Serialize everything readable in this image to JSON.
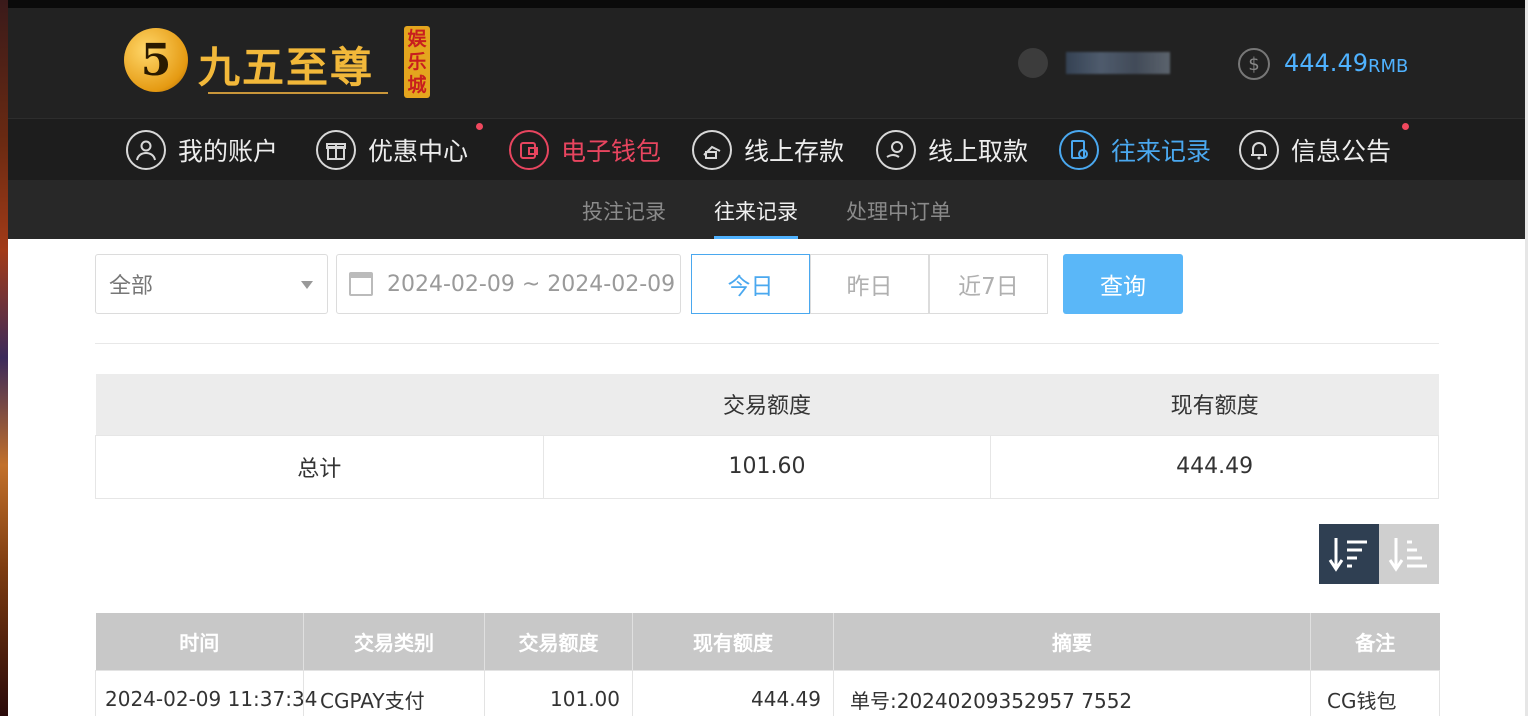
{
  "header": {
    "logo_badge": "5",
    "logo_text": "九五至尊",
    "logo_side": "娱乐城",
    "balance_amount": "444.49",
    "balance_unit": "RMB",
    "balance_icon": "dollar-icon"
  },
  "main_nav": [
    {
      "label": "我的账户",
      "icon": "user-icon",
      "state": "normal",
      "dot": false
    },
    {
      "label": "优惠中心",
      "icon": "gift-icon",
      "state": "normal",
      "dot": true
    },
    {
      "label": "电子钱包",
      "icon": "wallet-icon",
      "state": "active-red",
      "dot": false
    },
    {
      "label": "线上存款",
      "icon": "deposit-icon",
      "state": "normal",
      "dot": false
    },
    {
      "label": "线上取款",
      "icon": "withdraw-icon",
      "state": "normal",
      "dot": false
    },
    {
      "label": "往来记录",
      "icon": "record-icon",
      "state": "active-blue",
      "dot": false
    },
    {
      "label": "信息公告",
      "icon": "bell-icon",
      "state": "normal",
      "dot": true
    }
  ],
  "sub_nav": [
    {
      "label": "投注记录",
      "active": false
    },
    {
      "label": "往来记录",
      "active": true
    },
    {
      "label": "处理中订单",
      "active": false
    }
  ],
  "filters": {
    "type_select": "全部",
    "date_range": "2024-02-09 ~ 2024-02-09",
    "quick": [
      "今日",
      "昨日",
      "近7日"
    ],
    "quick_active": 0,
    "query_label": "查询"
  },
  "summary": {
    "headers": [
      "",
      "交易额度",
      "现有额度"
    ],
    "row": [
      "总计",
      "101.60",
      "444.49"
    ]
  },
  "detail": {
    "headers": [
      "时间",
      "交易类别",
      "交易额度",
      "现有额度",
      "摘要",
      "备注"
    ],
    "rows": [
      [
        "2024-02-09 11:37:34",
        "CGPAY支付",
        "101.00",
        "444.49",
        "单号:20240209352957 7552",
        "CG钱包"
      ]
    ]
  },
  "colors": {
    "accent_blue": "#4fb2ff",
    "accent_red": "#e8455f",
    "query_button": "#5ab7f8"
  }
}
